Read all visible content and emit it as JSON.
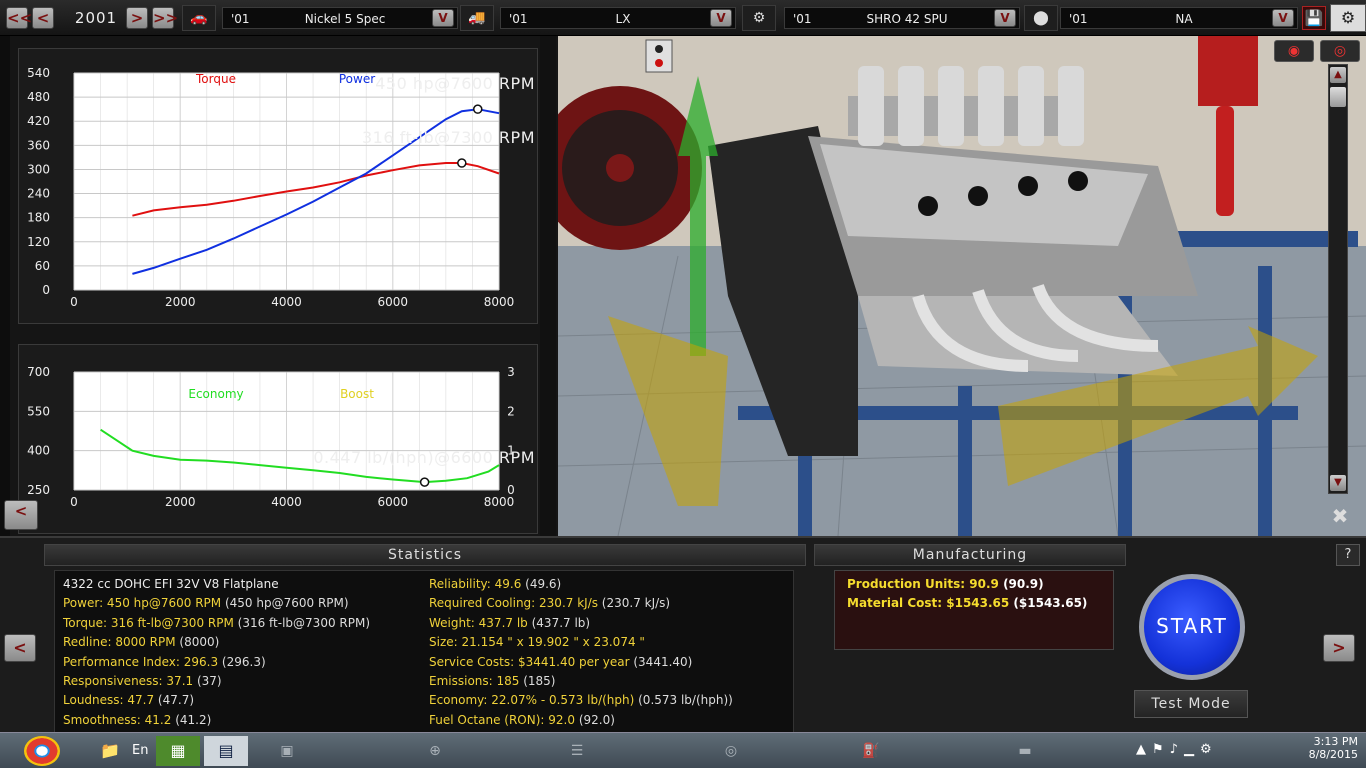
{
  "topbar": {
    "prev_fast": "<<",
    "prev": "<",
    "year": "2001",
    "next": ">",
    "next_fast": ">>",
    "selectors": [
      {
        "year": "'01",
        "name": "Nickel 5 Spec",
        "icon": "car-icon"
      },
      {
        "year": "'01",
        "name": "LX",
        "icon": "truck-icon"
      },
      {
        "year": "'01",
        "name": "SHRO 42 SPU",
        "icon": "engine-block-icon"
      },
      {
        "year": "'01",
        "name": "NA",
        "icon": "piston-icon"
      }
    ],
    "dropdown": "V",
    "save_icon": "save-icon"
  },
  "torque_chart": {
    "chart_data": {
      "type": "line",
      "x_ticks": [
        "0",
        "2000",
        "4000",
        "6000",
        "8000"
      ],
      "y_ticks": [
        "0",
        "60",
        "120",
        "180",
        "240",
        "300",
        "360",
        "420",
        "480",
        "540"
      ],
      "xlim": [
        0,
        8000
      ],
      "ylim": [
        0,
        540
      ],
      "grid": true,
      "series": [
        {
          "name": "Torque",
          "color": "#e01010",
          "x": [
            1100,
            1500,
            2000,
            2500,
            3000,
            3500,
            4000,
            4500,
            5000,
            5500,
            6000,
            6500,
            7000,
            7300,
            7600,
            8000
          ],
          "y": [
            185,
            198,
            206,
            212,
            222,
            234,
            245,
            255,
            268,
            285,
            298,
            310,
            316,
            316,
            308,
            290
          ]
        },
        {
          "name": "Power",
          "color": "#1030e0",
          "x": [
            1100,
            1500,
            2000,
            2500,
            3000,
            3500,
            4000,
            4500,
            5000,
            5500,
            6000,
            6500,
            7000,
            7300,
            7600,
            8000
          ],
          "y": [
            40,
            55,
            78,
            100,
            128,
            158,
            188,
            220,
            255,
            290,
            335,
            380,
            425,
            445,
            450,
            440
          ]
        }
      ],
      "annotations": [
        {
          "text": "450 hp@7600 RPM",
          "x": 7600,
          "y": 450
        },
        {
          "text": "316 ft-lb@7300 RPM",
          "x": 7300,
          "y": 316
        }
      ]
    }
  },
  "econ_chart": {
    "chart_data": {
      "type": "line",
      "x_ticks": [
        "0",
        "2000",
        "4000",
        "6000",
        "8000"
      ],
      "y_ticks_left": [
        "250",
        "400",
        "550",
        "700"
      ],
      "y_ticks_right": [
        "0",
        "1",
        "2",
        "3"
      ],
      "xlim": [
        0,
        8000
      ],
      "ylim": [
        250,
        700
      ],
      "grid": true,
      "series": [
        {
          "name": "Economy",
          "color": "#22dd22",
          "x": [
            500,
            800,
            1100,
            1500,
            2000,
            2500,
            3000,
            3500,
            4000,
            4500,
            5000,
            5500,
            6000,
            6600,
            7000,
            7400,
            7800,
            8000
          ],
          "y": [
            480,
            440,
            400,
            380,
            365,
            362,
            355,
            345,
            335,
            325,
            315,
            300,
            290,
            280,
            285,
            295,
            320,
            345
          ]
        },
        {
          "name": "Boost",
          "color": "#e0d020",
          "x": [],
          "y": []
        }
      ],
      "annotations": [
        {
          "text": "0.447 lb/(hph)@6600 RPM",
          "x": 6600,
          "y": 280
        }
      ]
    }
  },
  "nav_back": "<",
  "nav_forward": ">",
  "statistics": {
    "title": "Statistics",
    "engine": "4322 cc DOHC EFI 32V V8 Flatplane",
    "left": [
      {
        "k": "Power: 450 hp@7600 RPM",
        "v": " (450 hp@7600 RPM)"
      },
      {
        "k": "Torque: 316 ft-lb@7300 RPM",
        "v": " (316 ft-lb@7300 RPM)"
      },
      {
        "k": "Redline: 8000 RPM",
        "v": " (8000)"
      },
      {
        "k": "Performance Index: 296.3",
        "v": " (296.3)"
      },
      {
        "k": "Responsiveness: 37.1",
        "v": " (37)"
      },
      {
        "k": "Loudness: 47.7",
        "v": " (47.7)"
      },
      {
        "k": "Smoothness: 41.2",
        "v": " (41.2)"
      }
    ],
    "right": [
      {
        "k": "Reliability: 49.6",
        "v": " (49.6)"
      },
      {
        "k": "Required Cooling: 230.7 kJ/s",
        "v": " (230.7 kJ/s)"
      },
      {
        "k": "Weight: 437.7 lb",
        "v": " (437.7 lb)"
      },
      {
        "k": "Size: 21.154 \" x 19.902 \" x 23.074 \"",
        "v": ""
      },
      {
        "k": "Service Costs: $3441.40 per year",
        "v": " (3441.40)"
      },
      {
        "k": "Emissions: 185",
        "v": " (185)"
      },
      {
        "k": "Economy: 22.07% - 0.573 lb/(hph)",
        "v": " (0.573 lb/(hph))"
      },
      {
        "k": "Fuel Octane (RON): 92.0",
        "v": " (92.0)"
      }
    ]
  },
  "manufacturing": {
    "title": "Manufacturing",
    "lines": [
      {
        "k": "Production Units: 90.9",
        "v": " (90.9)"
      },
      {
        "k": "Material Cost: $1543.65",
        "v": " ($1543.65)"
      }
    ]
  },
  "start_label": "START",
  "test_mode_label": "Test Mode",
  "help_label": "?",
  "taskbar": {
    "start_orb": "windows-start-icon",
    "app_label": "En",
    "clock_time": "3:13 PM",
    "clock_date": "8/8/2015"
  }
}
